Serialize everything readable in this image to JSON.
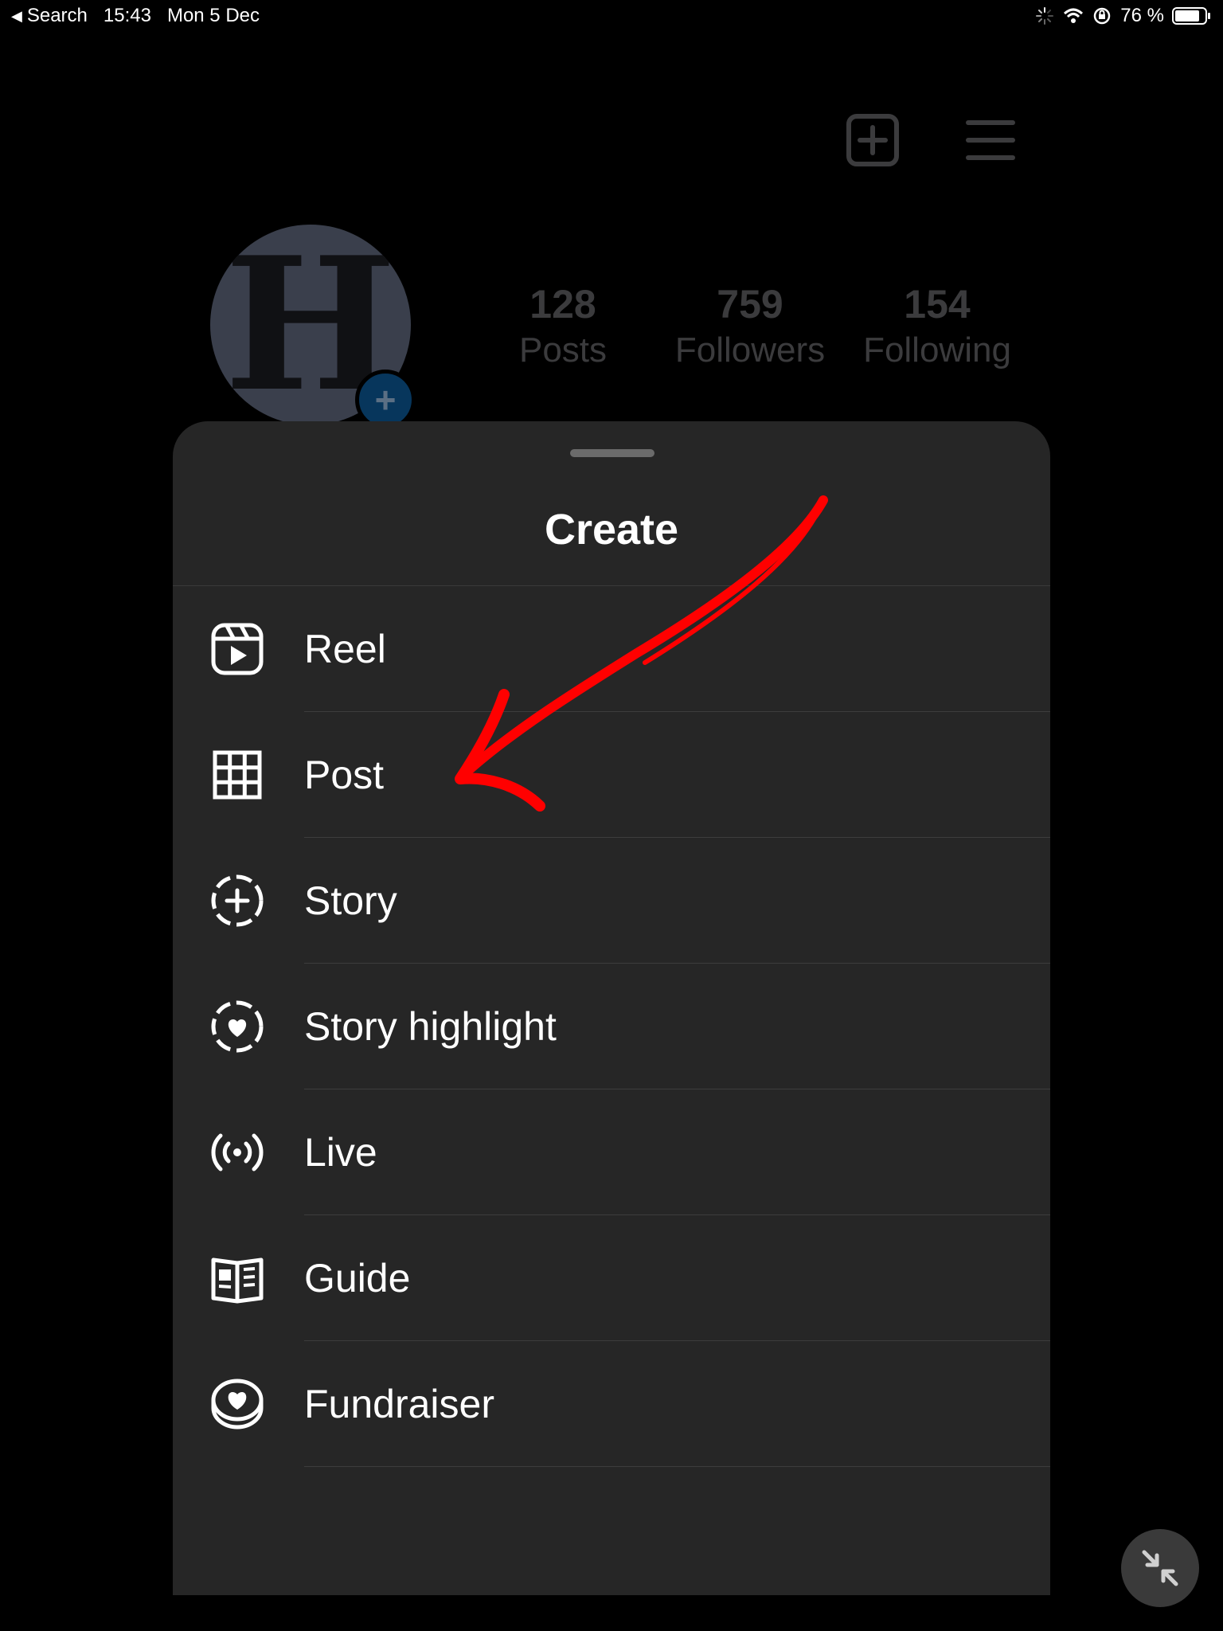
{
  "status_bar": {
    "back_label": "Search",
    "time": "15:43",
    "date": "Mon 5 Dec",
    "battery": "76 %",
    "icons": [
      "loading-icon",
      "wifi-icon",
      "orientation-lock-icon",
      "battery-icon"
    ]
  },
  "profile": {
    "avatar_letter": "H",
    "stats": [
      {
        "value": "128",
        "label": "Posts"
      },
      {
        "value": "759",
        "label": "Followers"
      },
      {
        "value": "154",
        "label": "Following"
      }
    ],
    "top_icons": [
      "new-post-icon",
      "menu-icon"
    ]
  },
  "sheet": {
    "title": "Create",
    "items": [
      {
        "label": "Reel",
        "icon": "reel-icon"
      },
      {
        "label": "Post",
        "icon": "grid-icon"
      },
      {
        "label": "Story",
        "icon": "story-add-icon"
      },
      {
        "label": "Story highlight",
        "icon": "story-highlight-icon"
      },
      {
        "label": "Live",
        "icon": "live-icon"
      },
      {
        "label": "Guide",
        "icon": "guide-icon"
      },
      {
        "label": "Fundraiser",
        "icon": "fundraiser-icon"
      }
    ]
  },
  "colors": {
    "background": "#000000",
    "sheet": "#262626",
    "annotation": "#ff0000",
    "avatar_badge": "#07365c"
  },
  "floating_button": {
    "icon": "minimize-arrows-icon"
  }
}
